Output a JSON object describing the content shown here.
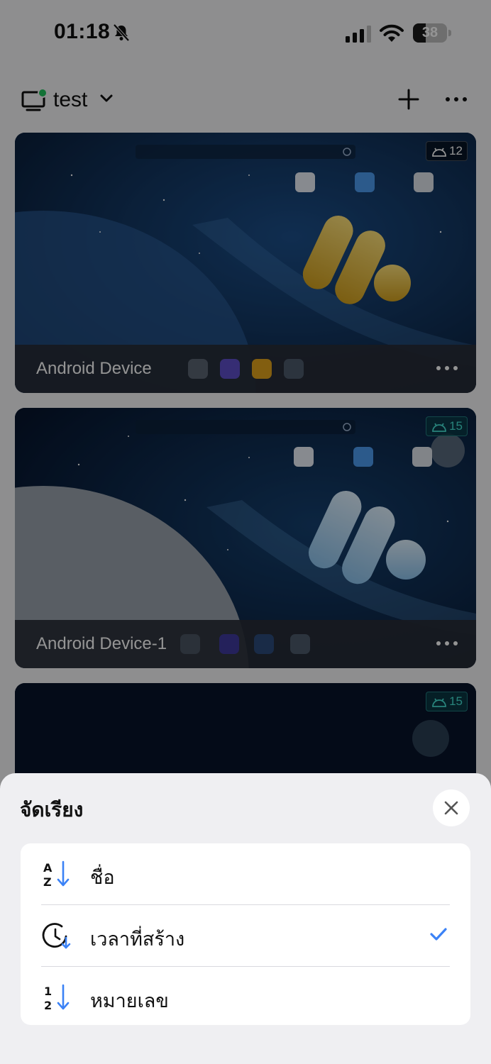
{
  "status_bar": {
    "time": "01:18",
    "battery": "38",
    "battery_level": 0.38
  },
  "header": {
    "title": "test",
    "icons": [
      "monitor-online-icon",
      "chevron-down-icon",
      "plus-icon",
      "more-horizontal-icon"
    ]
  },
  "devices": [
    {
      "name": "Android Device",
      "android_version": "12",
      "badge_style": "dark"
    },
    {
      "name": "Android Device-1",
      "android_version": "15",
      "badge_style": "teal"
    },
    {
      "name": "",
      "android_version": "15",
      "badge_style": "teal"
    }
  ],
  "sort_sheet": {
    "title": "จัดเรียง",
    "options": [
      {
        "label": "ชื่อ",
        "icon": "sort-alpha-icon",
        "selected": false
      },
      {
        "label": "เวลาที่สร้าง",
        "icon": "sort-time-icon",
        "selected": true
      },
      {
        "label": "หมายเลข",
        "icon": "sort-number-icon",
        "selected": false
      }
    ]
  },
  "colors": {
    "accent": "#3b82f6",
    "online": "#22c55e",
    "sheet_bg": "#efeff2",
    "badge_teal": "#46e2d4"
  }
}
